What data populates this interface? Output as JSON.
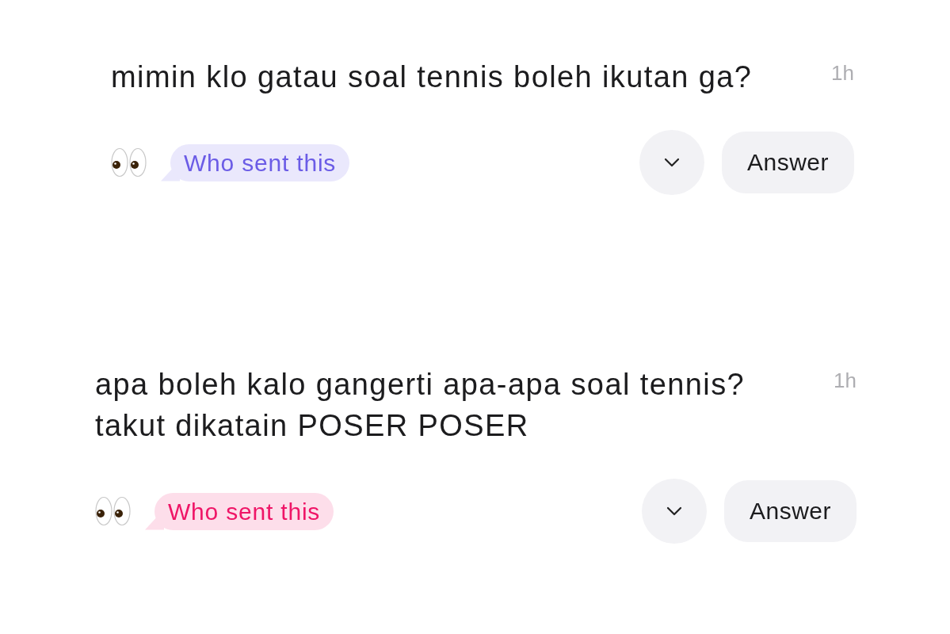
{
  "messages": [
    {
      "text": "mimin klo gatau soal tennis boleh ikutan ga?",
      "time": "1h",
      "badge": {
        "label": "Who sent this",
        "color": "#6b5ce6"
      },
      "answer_button": "Answer"
    },
    {
      "text": "apa boleh kalo gangerti apa-apa soal tennis? takut dikatain POSER POSER",
      "time": "1h",
      "badge": {
        "label": "Who sent this",
        "color": "#ef1567"
      },
      "answer_button": "Answer"
    }
  ]
}
